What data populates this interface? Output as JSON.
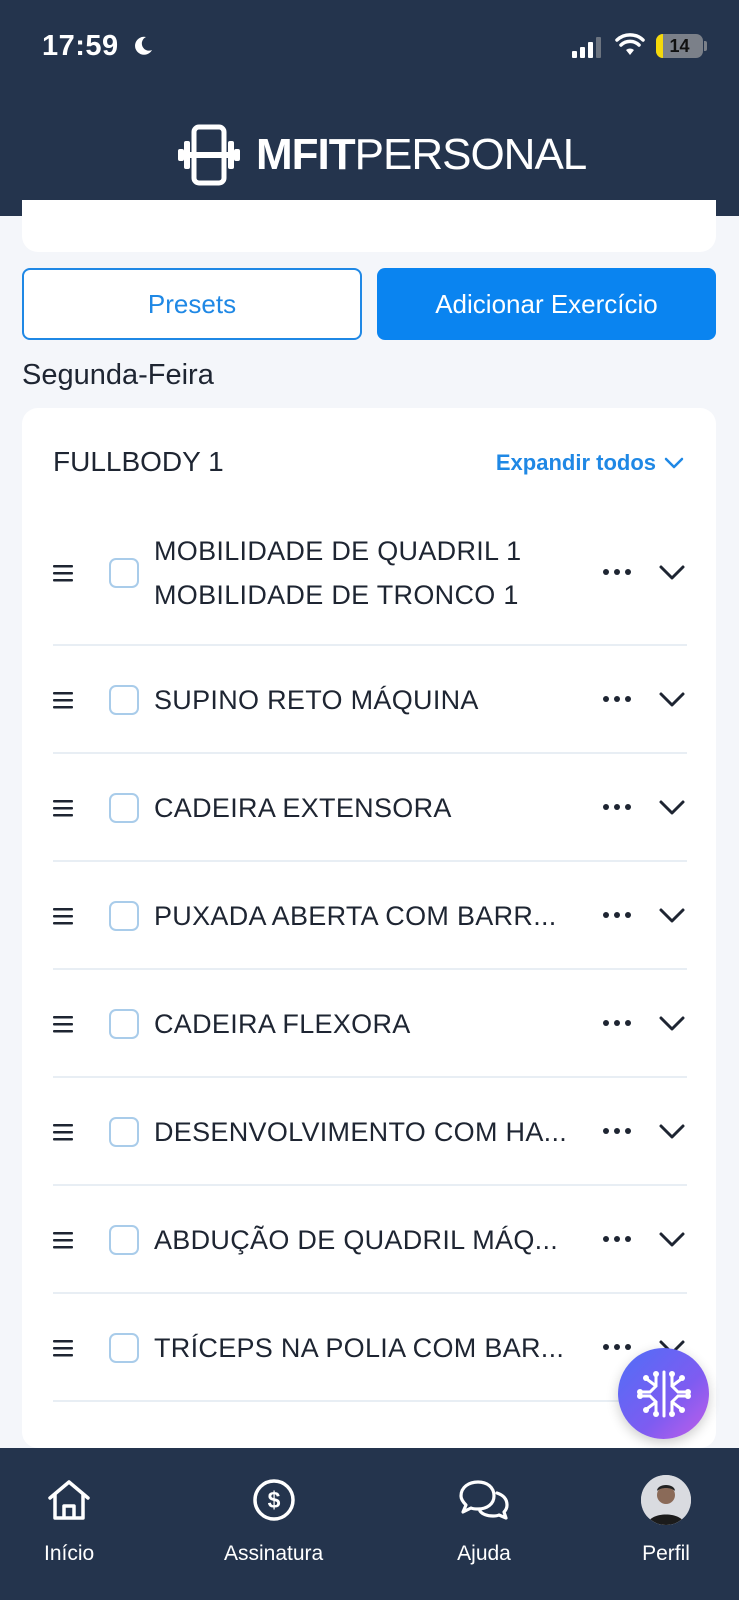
{
  "status_bar": {
    "time": "17:59",
    "battery": "14",
    "battery_level": 0.14
  },
  "brand": {
    "bold": "MFIT",
    "light": "PERSONAL"
  },
  "actions": {
    "presets": "Presets",
    "add_exercise": "Adicionar Exercício"
  },
  "day": "Segunda-Feira",
  "workout": {
    "title": "FULLBODY 1",
    "expand_all": "Expandir todos",
    "exercises": [
      {
        "lines": [
          "MOBILIDADE DE QUADRIL 1",
          "MOBILIDADE DE TRONCO 1"
        ]
      },
      {
        "lines": [
          "SUPINO RETO MÁQUINA"
        ]
      },
      {
        "lines": [
          "CADEIRA EXTENSORA"
        ]
      },
      {
        "lines": [
          "PUXADA ABERTA COM BARR..."
        ]
      },
      {
        "lines": [
          "CADEIRA FLEXORA"
        ]
      },
      {
        "lines": [
          "DESENVOLVIMENTO COM HA..."
        ]
      },
      {
        "lines": [
          "ABDUÇÃO DE QUADRIL MÁQ..."
        ]
      },
      {
        "lines": [
          "TRÍCEPS NA POLIA COM BAR..."
        ]
      }
    ]
  },
  "nav": [
    {
      "label": "Início",
      "icon": "home-icon"
    },
    {
      "label": "Assinatura",
      "icon": "dollar-circle-icon"
    },
    {
      "label": "Ajuda",
      "icon": "chat-bubbles-icon"
    },
    {
      "label": "Perfil",
      "icon": "avatar"
    }
  ],
  "colors": {
    "header": "#24344d",
    "accent": "#0a84f0",
    "text": "#1e2532"
  }
}
